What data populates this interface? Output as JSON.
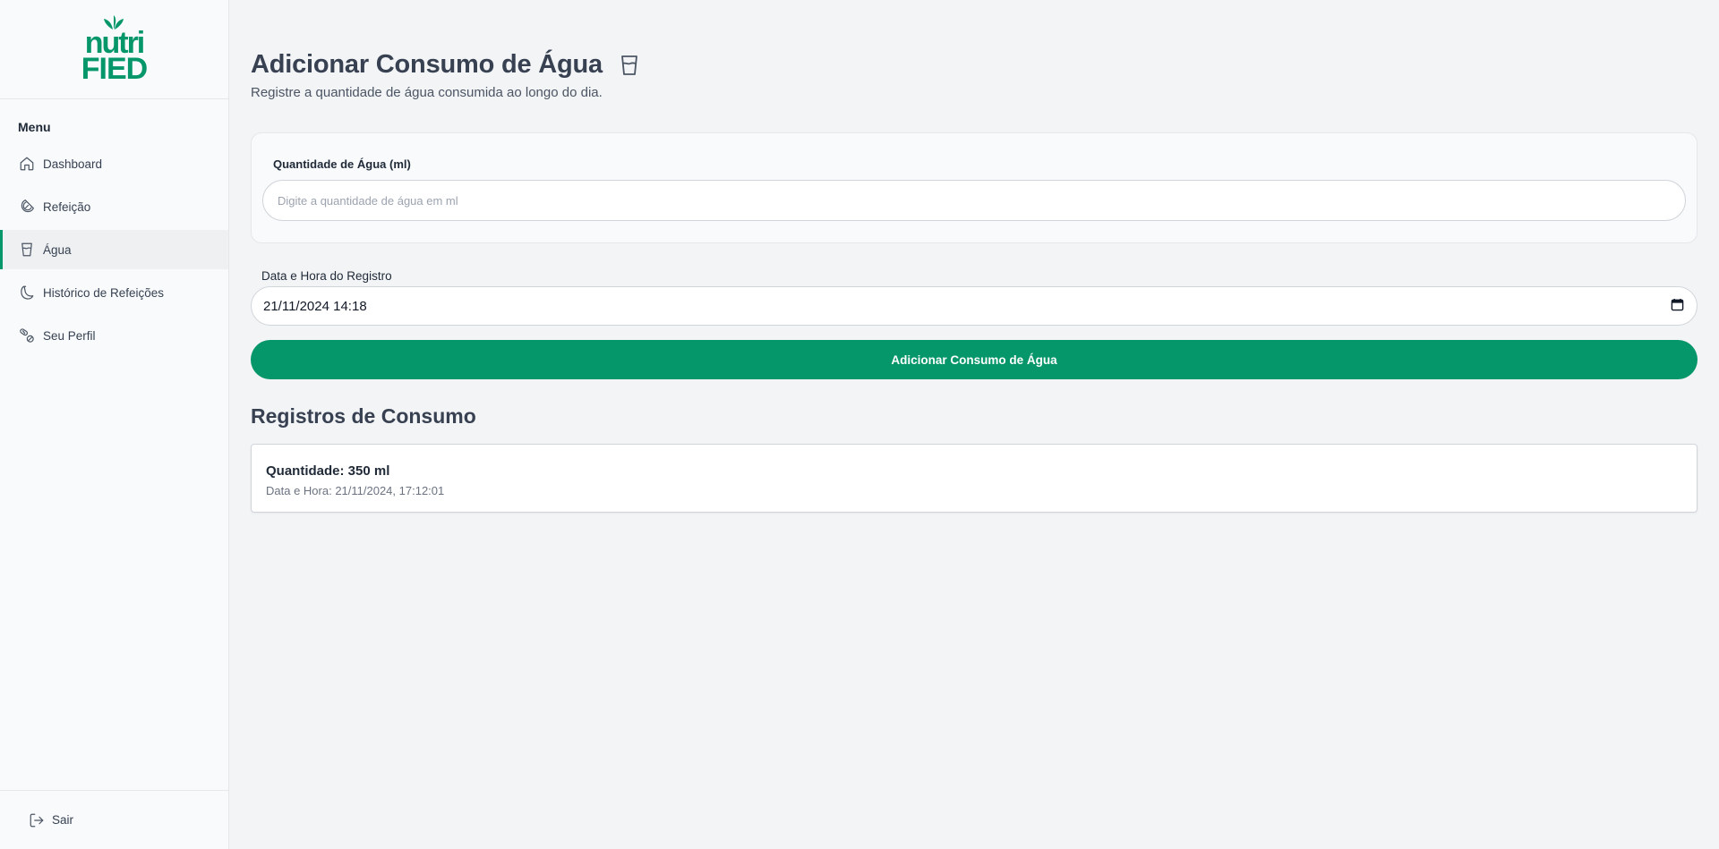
{
  "brand": {
    "line1": "nutri",
    "line2": "FIED",
    "color": "#059669"
  },
  "sidebar": {
    "menu_title": "Menu",
    "items": [
      {
        "label": "Dashboard",
        "icon": "home-icon",
        "active": false
      },
      {
        "label": "Refeição",
        "icon": "citrus-icon",
        "active": false
      },
      {
        "label": "Água",
        "icon": "glass-water-icon",
        "active": true
      },
      {
        "label": "Histórico de Refeições",
        "icon": "banana-icon",
        "active": false
      },
      {
        "label": "Seu Perfil",
        "icon": "pills-icon",
        "active": false
      }
    ],
    "logout_label": "Sair"
  },
  "main": {
    "title": "Adicionar Consumo de Água",
    "subtitle": "Registre a quantidade de água consumida ao longo do dia.",
    "form": {
      "quantity_label": "Quantidade de Água (ml)",
      "quantity_placeholder": "Digite a quantidade de água em ml",
      "datetime_label": "Data e Hora do Registro",
      "datetime_value": "21/11/2024 14:18",
      "submit_label": "Adicionar Consumo de Água"
    },
    "records_title": "Registros de Consumo",
    "records": [
      {
        "quantity": "Quantidade: 350 ml",
        "datetime": "Data e Hora: 21/11/2024, 17:12:01"
      }
    ]
  },
  "colors": {
    "accent": "#059669",
    "background": "#f3f4f6"
  }
}
